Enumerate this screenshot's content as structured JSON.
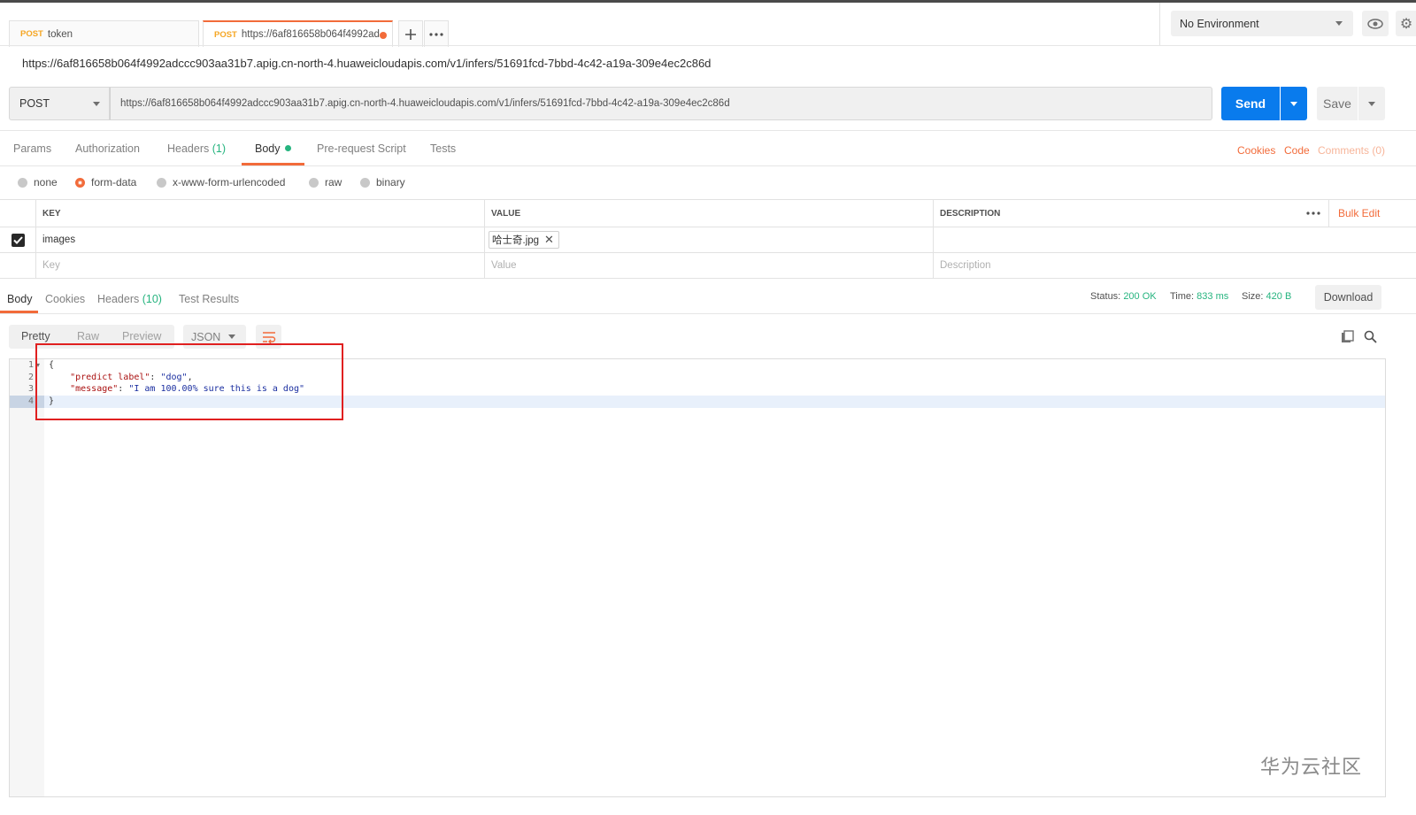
{
  "tabs": [
    {
      "method": "POST",
      "label": "token"
    },
    {
      "method": "POST",
      "label": "https://6af816658b064f4992ad"
    }
  ],
  "environment": {
    "selected": "No Environment"
  },
  "request": {
    "title_url": "https://6af816658b064f4992adccc903aa31b7.apig.cn-north-4.huaweicloudapis.com/v1/infers/51691fcd-7bbd-4c42-a19a-309e4ec2c86d",
    "method": "POST",
    "url": "https://6af816658b064f4992adccc903aa31b7.apig.cn-north-4.huaweicloudapis.com/v1/infers/51691fcd-7bbd-4c42-a19a-309e4ec2c86d",
    "send_label": "Send",
    "save_label": "Save"
  },
  "request_tabs": {
    "params": "Params",
    "authorization": "Authorization",
    "headers": "Headers",
    "headers_count": "(1)",
    "body": "Body",
    "prerequest": "Pre-request Script",
    "tests": "Tests",
    "cookies": "Cookies",
    "code": "Code",
    "comments": "Comments (0)"
  },
  "body_types": {
    "none": "none",
    "form_data": "form-data",
    "urlencoded": "x-www-form-urlencoded",
    "raw": "raw",
    "binary": "binary"
  },
  "table": {
    "headers": {
      "key": "KEY",
      "value": "VALUE",
      "description": "DESCRIPTION"
    },
    "bulk_edit": "Bulk Edit",
    "rows": [
      {
        "key": "images",
        "value_file": "哈士奇.jpg",
        "description": ""
      }
    ],
    "placeholder": {
      "key": "Key",
      "value": "Value",
      "description": "Description"
    }
  },
  "response": {
    "tabs": {
      "body": "Body",
      "cookies": "Cookies",
      "headers": "Headers",
      "headers_count": "(10)",
      "test_results": "Test Results"
    },
    "status_label": "Status:",
    "status": "200 OK",
    "time_label": "Time:",
    "time": "833 ms",
    "size_label": "Size:",
    "size": "420 B",
    "download": "Download",
    "formats": {
      "pretty": "Pretty",
      "raw": "Raw",
      "preview": "Preview",
      "json": "JSON"
    },
    "code": {
      "line1": "{",
      "line2_key": "\"predict label\"",
      "line2_val": "\"dog\"",
      "line3_key": "\"message\"",
      "line3_val": "\"I am 100.00% sure this is a dog\"",
      "line4": "}"
    },
    "line_numbers": [
      "1",
      "2",
      "3",
      "4"
    ]
  },
  "watermark": "华为云社区",
  "colors": {
    "accent": "#f26b3a",
    "send": "#097bed",
    "success": "#26b47f"
  }
}
